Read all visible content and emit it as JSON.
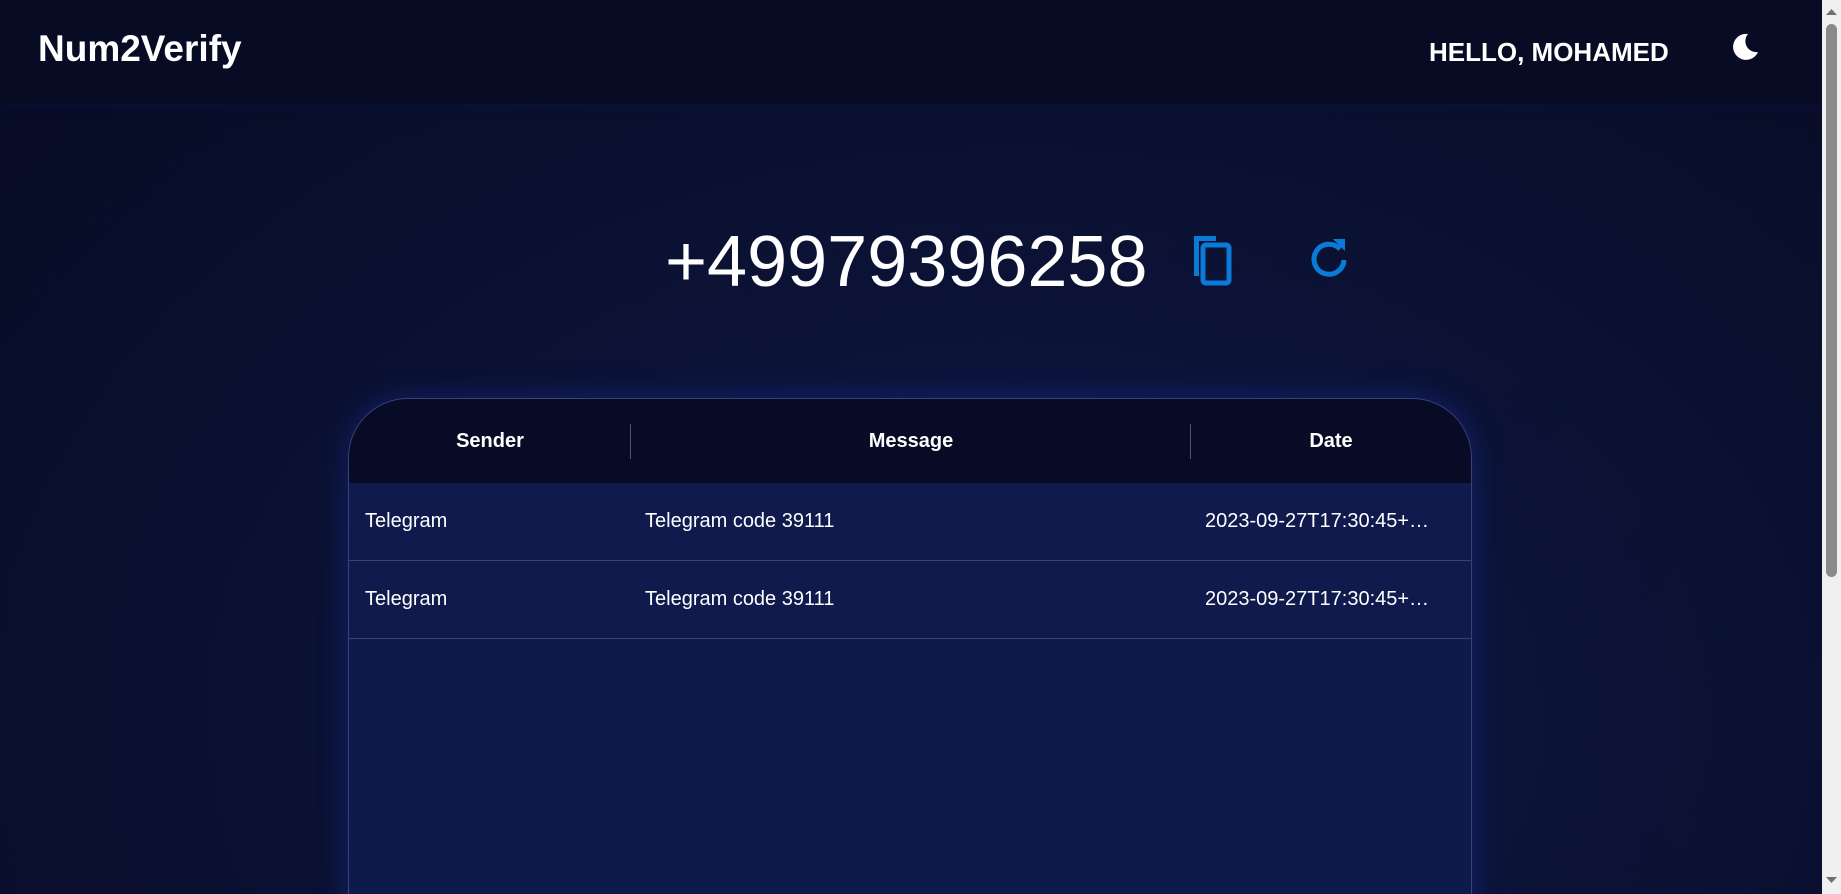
{
  "header": {
    "brand": "Num2Verify",
    "greeting": "HELLO, MOHAMED",
    "theme_icon": "moon-icon"
  },
  "number_panel": {
    "phone_number": "+49979396258",
    "copy_icon": "copy-icon",
    "refresh_icon": "refresh-icon",
    "accent_color": "#0a7bd6"
  },
  "messages_table": {
    "columns": [
      "Sender",
      "Message",
      "Date"
    ],
    "rows": [
      {
        "sender": "Telegram",
        "message": "Telegram code 39111",
        "date": "2023-09-27T17:30:45+…"
      },
      {
        "sender": "Telegram",
        "message": "Telegram code 39111",
        "date": "2023-09-27T17:30:45+…"
      }
    ]
  },
  "colors": {
    "background": "#0b1235",
    "header": "#070b24",
    "table_body": "#101a4d"
  }
}
